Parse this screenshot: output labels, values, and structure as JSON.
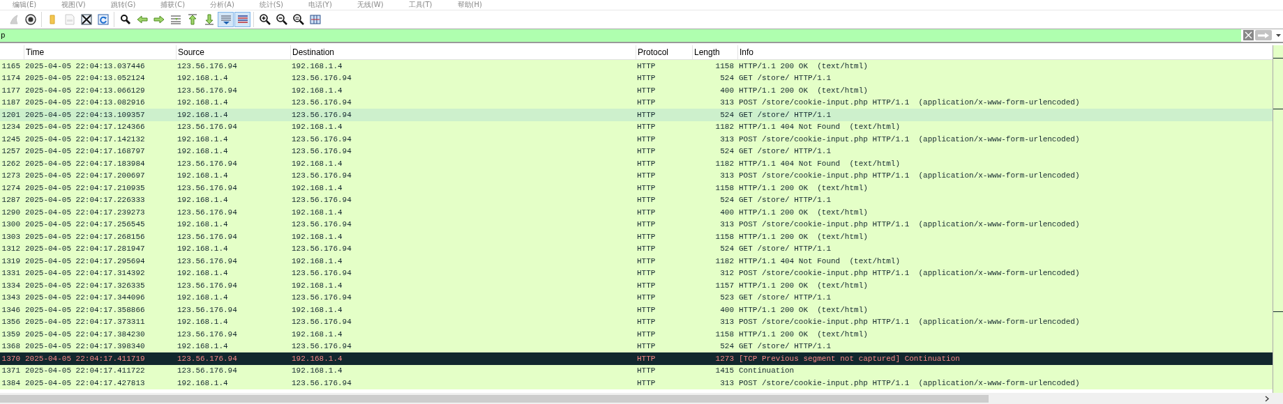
{
  "menu": [
    "编辑(E)",
    "视图(V)",
    "跳转(G)",
    "捕获(C)",
    "分析(A)",
    "统计(S)",
    "电话(Y)",
    "无线(W)",
    "工具(T)",
    "帮助(H)"
  ],
  "toolbar": {
    "groups": [
      [
        {
          "kind": "fin",
          "pressed": false,
          "disabled": true
        },
        {
          "kind": "options",
          "pressed": false,
          "disabled": false
        }
      ],
      [
        {
          "kind": "open",
          "pressed": false,
          "disabled": false
        },
        {
          "kind": "file",
          "pressed": false,
          "disabled": true
        },
        {
          "kind": "close",
          "pressed": false,
          "disabled": false
        },
        {
          "kind": "reload",
          "pressed": false,
          "disabled": false
        }
      ],
      [
        {
          "kind": "find",
          "pressed": false,
          "disabled": false
        },
        {
          "kind": "back",
          "pressed": false,
          "disabled": false
        },
        {
          "kind": "forward",
          "pressed": false,
          "disabled": false
        },
        {
          "kind": "goto",
          "pressed": false,
          "disabled": false
        },
        {
          "kind": "first",
          "pressed": false,
          "disabled": false
        },
        {
          "kind": "last",
          "pressed": false,
          "disabled": false
        },
        {
          "kind": "autoscroll",
          "pressed": true,
          "disabled": false
        },
        {
          "kind": "colorize",
          "pressed": true,
          "disabled": false
        }
      ],
      [
        {
          "kind": "zoom_in",
          "pressed": false,
          "disabled": false
        },
        {
          "kind": "zoom_out",
          "pressed": false,
          "disabled": false
        },
        {
          "kind": "zoom_reset",
          "pressed": false,
          "disabled": false
        },
        {
          "kind": "resize",
          "pressed": false,
          "disabled": false
        }
      ]
    ]
  },
  "filter": {
    "value": "p"
  },
  "table": {
    "columns": [
      "Time",
      "Source",
      "Destination",
      "Protocol",
      "Length",
      "Info"
    ],
    "rows": [
      {
        "no": "1165",
        "time": "2025-04-05 22:04:13.037446",
        "source": "123.56.176.94",
        "destination": "192.168.1.4",
        "protocol": "HTTP",
        "length": "1158",
        "info": "HTTP/1.1 200 OK  (text/html)",
        "kind": "normal",
        "selected": false
      },
      {
        "no": "1174",
        "time": "2025-04-05 22:04:13.052124",
        "source": "192.168.1.4",
        "destination": "123.56.176.94",
        "protocol": "HTTP",
        "length": "524",
        "info": "GET /store/ HTTP/1.1",
        "kind": "normal",
        "selected": false
      },
      {
        "no": "1177",
        "time": "2025-04-05 22:04:13.066129",
        "source": "123.56.176.94",
        "destination": "192.168.1.4",
        "protocol": "HTTP",
        "length": "400",
        "info": "HTTP/1.1 200 OK  (text/html)",
        "kind": "normal",
        "selected": false
      },
      {
        "no": "1187",
        "time": "2025-04-05 22:04:13.082916",
        "source": "192.168.1.4",
        "destination": "123.56.176.94",
        "protocol": "HTTP",
        "length": "313",
        "info": "POST /store/cookie-input.php HTTP/1.1  (application/x-www-form-urlencoded)",
        "kind": "normal",
        "selected": false
      },
      {
        "no": "1201",
        "time": "2025-04-05 22:04:13.109357",
        "source": "192.168.1.4",
        "destination": "123.56.176.94",
        "protocol": "HTTP",
        "length": "524",
        "info": "GET /store/ HTTP/1.1",
        "kind": "normal",
        "selected": true
      },
      {
        "no": "1234",
        "time": "2025-04-05 22:04:17.124366",
        "source": "123.56.176.94",
        "destination": "192.168.1.4",
        "protocol": "HTTP",
        "length": "1182",
        "info": "HTTP/1.1 404 Not Found  (text/html)",
        "kind": "normal",
        "selected": false
      },
      {
        "no": "1245",
        "time": "2025-04-05 22:04:17.142132",
        "source": "192.168.1.4",
        "destination": "123.56.176.94",
        "protocol": "HTTP",
        "length": "313",
        "info": "POST /store/cookie-input.php HTTP/1.1  (application/x-www-form-urlencoded)",
        "kind": "normal",
        "selected": false
      },
      {
        "no": "1257",
        "time": "2025-04-05 22:04:17.168797",
        "source": "192.168.1.4",
        "destination": "123.56.176.94",
        "protocol": "HTTP",
        "length": "524",
        "info": "GET /store/ HTTP/1.1",
        "kind": "normal",
        "selected": false
      },
      {
        "no": "1262",
        "time": "2025-04-05 22:04:17.183984",
        "source": "123.56.176.94",
        "destination": "192.168.1.4",
        "protocol": "HTTP",
        "length": "1182",
        "info": "HTTP/1.1 404 Not Found  (text/html)",
        "kind": "normal",
        "selected": false
      },
      {
        "no": "1273",
        "time": "2025-04-05 22:04:17.200697",
        "source": "192.168.1.4",
        "destination": "123.56.176.94",
        "protocol": "HTTP",
        "length": "313",
        "info": "POST /store/cookie-input.php HTTP/1.1  (application/x-www-form-urlencoded)",
        "kind": "normal",
        "selected": false
      },
      {
        "no": "1274",
        "time": "2025-04-05 22:04:17.210935",
        "source": "123.56.176.94",
        "destination": "192.168.1.4",
        "protocol": "HTTP",
        "length": "1158",
        "info": "HTTP/1.1 200 OK  (text/html)",
        "kind": "normal",
        "selected": false
      },
      {
        "no": "1287",
        "time": "2025-04-05 22:04:17.226333",
        "source": "192.168.1.4",
        "destination": "123.56.176.94",
        "protocol": "HTTP",
        "length": "524",
        "info": "GET /store/ HTTP/1.1",
        "kind": "normal",
        "selected": false
      },
      {
        "no": "1290",
        "time": "2025-04-05 22:04:17.239273",
        "source": "123.56.176.94",
        "destination": "192.168.1.4",
        "protocol": "HTTP",
        "length": "400",
        "info": "HTTP/1.1 200 OK  (text/html)",
        "kind": "normal",
        "selected": false
      },
      {
        "no": "1300",
        "time": "2025-04-05 22:04:17.256545",
        "source": "192.168.1.4",
        "destination": "123.56.176.94",
        "protocol": "HTTP",
        "length": "313",
        "info": "POST /store/cookie-input.php HTTP/1.1  (application/x-www-form-urlencoded)",
        "kind": "normal",
        "selected": false
      },
      {
        "no": "1303",
        "time": "2025-04-05 22:04:17.268156",
        "source": "123.56.176.94",
        "destination": "192.168.1.4",
        "protocol": "HTTP",
        "length": "1158",
        "info": "HTTP/1.1 200 OK  (text/html)",
        "kind": "normal",
        "selected": false
      },
      {
        "no": "1312",
        "time": "2025-04-05 22:04:17.281947",
        "source": "192.168.1.4",
        "destination": "123.56.176.94",
        "protocol": "HTTP",
        "length": "524",
        "info": "GET /store/ HTTP/1.1",
        "kind": "normal",
        "selected": false
      },
      {
        "no": "1319",
        "time": "2025-04-05 22:04:17.295694",
        "source": "123.56.176.94",
        "destination": "192.168.1.4",
        "protocol": "HTTP",
        "length": "1182",
        "info": "HTTP/1.1 404 Not Found  (text/html)",
        "kind": "normal",
        "selected": false
      },
      {
        "no": "1331",
        "time": "2025-04-05 22:04:17.314392",
        "source": "192.168.1.4",
        "destination": "123.56.176.94",
        "protocol": "HTTP",
        "length": "312",
        "info": "POST /store/cookie-input.php HTTP/1.1  (application/x-www-form-urlencoded)",
        "kind": "normal",
        "selected": false
      },
      {
        "no": "1334",
        "time": "2025-04-05 22:04:17.326335",
        "source": "123.56.176.94",
        "destination": "192.168.1.4",
        "protocol": "HTTP",
        "length": "1157",
        "info": "HTTP/1.1 200 OK  (text/html)",
        "kind": "normal",
        "selected": false
      },
      {
        "no": "1343",
        "time": "2025-04-05 22:04:17.344096",
        "source": "192.168.1.4",
        "destination": "123.56.176.94",
        "protocol": "HTTP",
        "length": "523",
        "info": "GET /store/ HTTP/1.1",
        "kind": "normal",
        "selected": false
      },
      {
        "no": "1346",
        "time": "2025-04-05 22:04:17.358866",
        "source": "123.56.176.94",
        "destination": "192.168.1.4",
        "protocol": "HTTP",
        "length": "400",
        "info": "HTTP/1.1 200 OK  (text/html)",
        "kind": "normal",
        "selected": false
      },
      {
        "no": "1356",
        "time": "2025-04-05 22:04:17.373311",
        "source": "192.168.1.4",
        "destination": "123.56.176.94",
        "protocol": "HTTP",
        "length": "313",
        "info": "POST /store/cookie-input.php HTTP/1.1  (application/x-www-form-urlencoded)",
        "kind": "normal",
        "selected": false
      },
      {
        "no": "1359",
        "time": "2025-04-05 22:04:17.384230",
        "source": "123.56.176.94",
        "destination": "192.168.1.4",
        "protocol": "HTTP",
        "length": "1158",
        "info": "HTTP/1.1 200 OK  (text/html)",
        "kind": "normal",
        "selected": false
      },
      {
        "no": "1368",
        "time": "2025-04-05 22:04:17.398340",
        "source": "192.168.1.4",
        "destination": "123.56.176.94",
        "protocol": "HTTP",
        "length": "524",
        "info": "GET /store/ HTTP/1.1",
        "kind": "normal",
        "selected": false
      },
      {
        "no": "1370",
        "time": "2025-04-05 22:04:17.411719",
        "source": "123.56.176.94",
        "destination": "192.168.1.4",
        "protocol": "HTTP",
        "length": "1273",
        "info": "[TCP Previous segment not captured] Continuation",
        "kind": "bad",
        "selected": false
      },
      {
        "no": "1371",
        "time": "2025-04-05 22:04:17.411722",
        "source": "123.56.176.94",
        "destination": "192.168.1.4",
        "protocol": "HTTP",
        "length": "1415",
        "info": "Continuation",
        "kind": "normal",
        "selected": false
      },
      {
        "no": "1384",
        "time": "2025-04-05 22:04:17.427813",
        "source": "192.168.1.4",
        "destination": "123.56.176.94",
        "protocol": "HTTP",
        "length": "313",
        "info": "POST /store/cookie-input.php HTTP/1.1  (application/x-www-form-urlencoded)",
        "kind": "normal",
        "selected": false
      }
    ]
  }
}
